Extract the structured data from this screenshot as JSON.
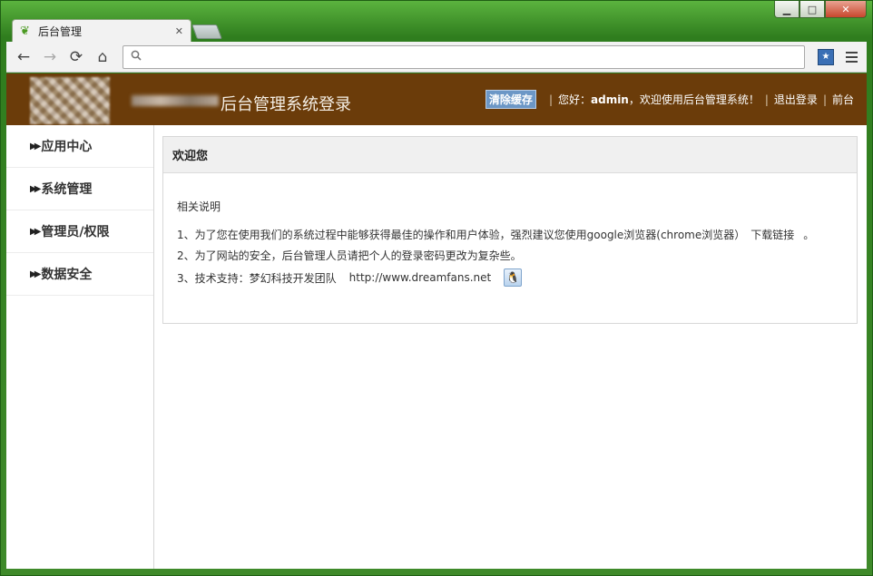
{
  "browser": {
    "tab_title": "后台管理",
    "tab_close": "✕",
    "window_controls": {
      "minimize": "▁",
      "maximize": "□",
      "close": "✕"
    },
    "nav": {
      "back": "←",
      "forward": "→",
      "reload": "⟳",
      "home": "⌂"
    },
    "omnibox_value": "",
    "icons": {
      "favicon": "leaf-icon",
      "search": "search-icon",
      "bookmark": "bookmark-star-icon",
      "menu": "menu-icon"
    }
  },
  "header": {
    "title": "后台管理系统登录",
    "clear_cache": "清除缓存",
    "greeting_prefix": "您好：",
    "username": "admin",
    "greeting_suffix": "，欢迎使用后台管理系统！",
    "logout": "退出登录",
    "frontend": "前台",
    "separator": "|"
  },
  "sidebar": {
    "items": [
      {
        "label": "应用中心"
      },
      {
        "label": "系统管理"
      },
      {
        "label": "管理员/权限"
      },
      {
        "label": "数据安全"
      }
    ],
    "arrow": "▶▶"
  },
  "main": {
    "panel_title": "欢迎您",
    "subtitle": "相关说明",
    "line1_text": "1、为了您在使用我们的系统过程中能够获得最佳的操作和用户体验，强烈建议您使用google浏览器(chrome浏览器）",
    "line1_link": "下载链接",
    "line1_end": "。",
    "line2": "2、为了网站的安全，后台管理人员请把个人的登录密码更改为复杂些。",
    "line3_text": "3、技术支持：梦幻科技开发团队",
    "line3_link": "http://www.dreamfans.net",
    "qq_icon": "qq-penguin-icon"
  },
  "colors": {
    "header_bg": "#6b3c0a",
    "frame_green": "#3f8a2a",
    "clear_cache_bg": "#6c97c6"
  }
}
